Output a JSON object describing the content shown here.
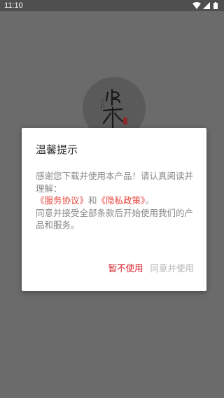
{
  "status_bar": {
    "time": "11:10",
    "icons": [
      "wifi-icon",
      "signal-icon",
      "battery-icon"
    ]
  },
  "background": {
    "logo": {
      "name": "app-logo"
    }
  },
  "dialog": {
    "title": "温馨提示",
    "line1": "感谢您下载并使用本产品！请认真阅读并理解：",
    "service_link": "《服务协议》",
    "conjunction": "和",
    "privacy_link": "《隐私政策》",
    "end_mark": "。",
    "line3": "同意并接受全部条款后开始使用我们的产品和服务。",
    "decline_label": "暂不使用",
    "agree_label": "同意并使用"
  },
  "colors": {
    "overlay": "#6b6b6b",
    "accent_link": "#e8453c",
    "decline": "#d8202a",
    "agree": "#b3b3b3",
    "body_text": "#888888"
  }
}
